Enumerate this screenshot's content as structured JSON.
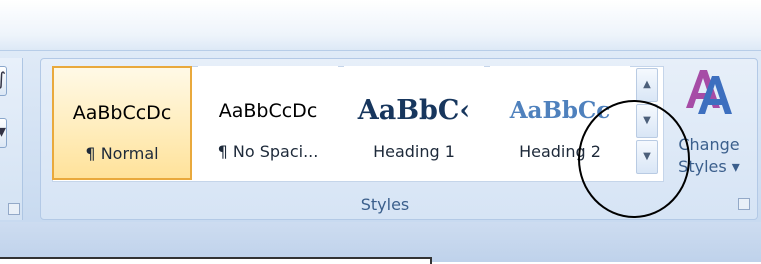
{
  "ribbon": {
    "group_label": "Styles",
    "styles_gallery": {
      "items": [
        {
          "sample": "AaBbCcDc",
          "name": "¶ Normal",
          "selected": true
        },
        {
          "sample": "AaBbCcDc",
          "name": "¶ No Spaci...",
          "selected": false
        },
        {
          "sample": "AaBbC‹",
          "name": "Heading 1",
          "selected": false
        },
        {
          "sample": "AaBbCc",
          "name": "Heading 2",
          "selected": false
        }
      ]
    },
    "change_styles": {
      "line1": "Change",
      "line2": "Styles ▾"
    }
  },
  "colors": {
    "selected_border": "#e9a93c",
    "heading1": "#17365d",
    "heading2": "#4f81bd",
    "ribbon_text": "#3b5f8c"
  },
  "icons": {
    "gallery_up": "scroll-up-icon",
    "gallery_down": "scroll-down-icon",
    "gallery_more": "more-icon",
    "change_styles": "change-styles-icon",
    "dialog_launcher": "dialog-launcher-icon"
  }
}
